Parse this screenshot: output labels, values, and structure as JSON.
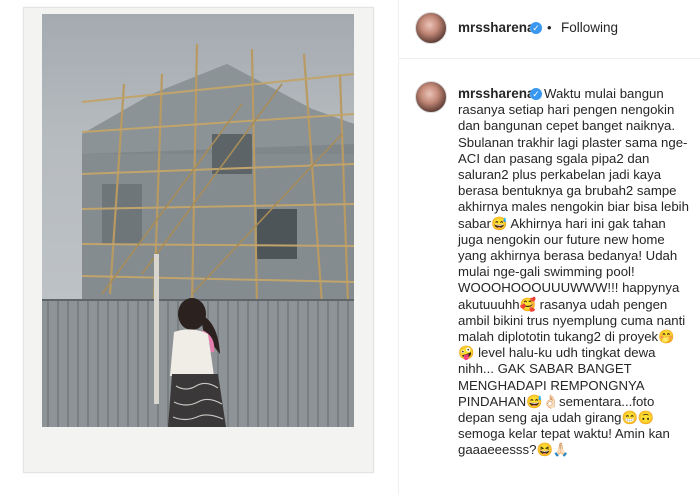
{
  "post": {
    "username": "mrssharena",
    "follow_state": "Following",
    "separator": "•",
    "verified_mark": "✓",
    "caption": "Waktu mulai bangun rasanya setiap hari pengen nengokin dan bangunan cepet banget naiknya. Sbulanan trakhir lagi plaster sama nge-ACI dan pasang sgala pipa2 dan saluran2 plus perkabelan jadi kaya berasa bentuknya ga brubah2 sampe akhirnya males nengokin biar bisa lebih sabar😅 Akhirnya hari ini gak tahan juga nengokin our future new home yang akhirnya berasa bedanya! Udah mulai nge-gali swimming pool! WOOOHOOOUUUWWW!!! happynya akutuuuhh🥰 rasanya udah pengen ambil bikini trus nyemplung cuma nanti malah diplototin tukang2 di proyek🤭 🤪 level halu-ku udh tingkat dewa nihh... GAK SABAR BANGET MENGHADAPI REMPONGNYA PINDAHAN😅👌🏻sementara...foto depan seng aja udah girang😁🙃 semoga kelar tepat waktu! Amin kan gaaaeeesss?😆🙏🏻"
  },
  "colors": {
    "verified": "#3897f0",
    "text": "#262626",
    "border": "#efefef"
  },
  "icons": {
    "verified": "verified-badge-icon"
  }
}
